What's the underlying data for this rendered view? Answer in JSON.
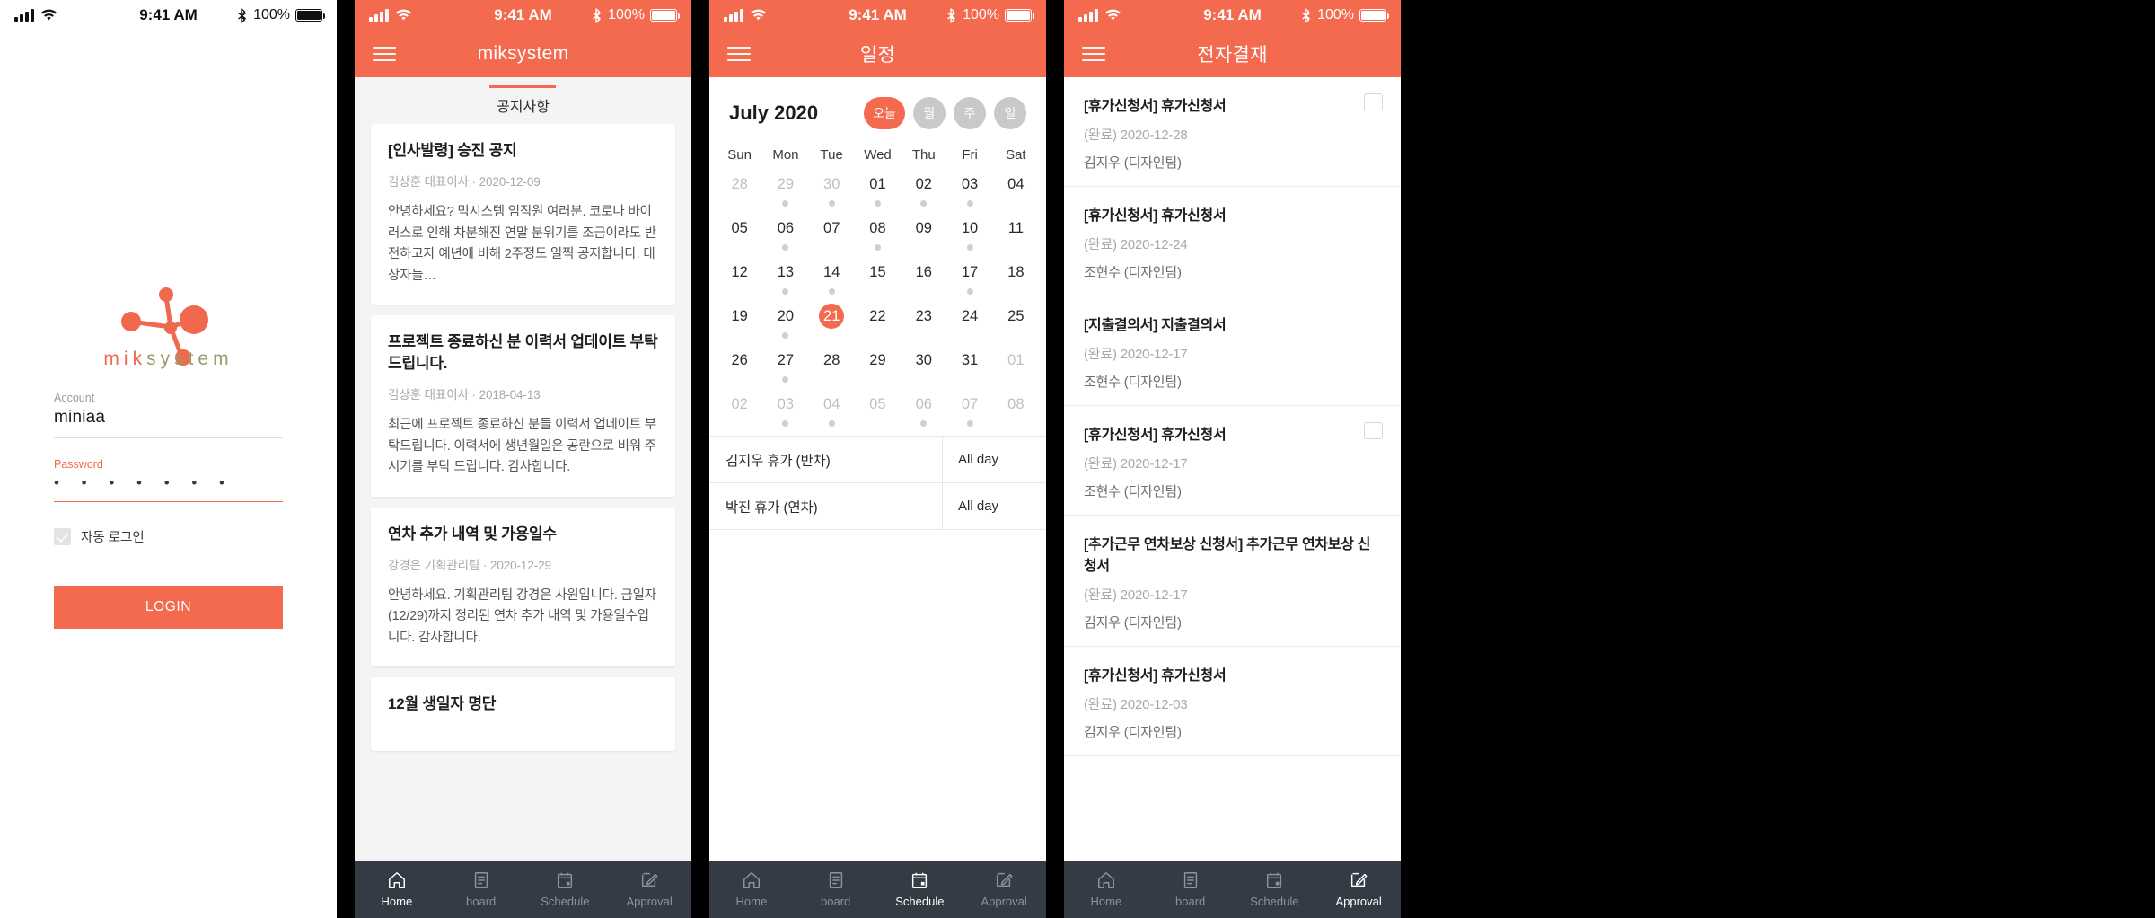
{
  "theme": {
    "accent": "#f36a4f",
    "nav_bg": "#343b45",
    "page_bg": "#f4f4f4"
  },
  "status_bar": {
    "time": "9:41 AM",
    "battery": "100%",
    "signal_icon": "cellular-signal-icon",
    "wifi_icon": "wifi-icon",
    "bluetooth_icon": "bluetooth-icon",
    "battery_icon": "battery-icon"
  },
  "bottom_nav": {
    "items": [
      {
        "label": "Home",
        "icon": "home-icon"
      },
      {
        "label": "board",
        "icon": "document-icon"
      },
      {
        "label": "Schedule",
        "icon": "calendar-icon"
      },
      {
        "label": "Approval",
        "icon": "edit-pencil-icon"
      }
    ]
  },
  "screen_login": {
    "logo": {
      "brand_part_1": "mik",
      "brand_part_2": "system",
      "mark_icon": "miksystem-molecule-logo"
    },
    "account": {
      "label": "Account",
      "value": "miniaa"
    },
    "password": {
      "label": "Password",
      "value": "•  •  •  •  •  •  •"
    },
    "remember": {
      "label": "자동 로그인",
      "checked": true
    },
    "login_button": "LOGIN"
  },
  "screen_board": {
    "app_title": "miksystem",
    "tab": "공지사항",
    "cards": [
      {
        "title": "[인사발령] 승진 공지",
        "meta": "김상훈 대표이사 · 2020-12-09",
        "body": "안녕하세요? 믹시스템 임직원 여러분. 코로나 바이러스로 인해 차분해진 연말 분위기를 조금이라도 반전하고자 예년에 비해 2주정도 일찍 공지합니다. 대상자들…"
      },
      {
        "title": "프로젝트 종료하신 분 이력서 업데이트 부탁드립니다.",
        "meta": "김상훈 대표이사 · 2018-04-13",
        "body": "최근에 프로젝트 종료하신 분들 이력서 업데이트 부탁드립니다. 이력서에 생년월일은 공란으로 비워 주시기를 부탁 드립니다. 감사합니다."
      },
      {
        "title": "연차 추가 내역 및 가용일수",
        "meta": "강경은 기획관리팀  · 2020-12-29",
        "body": "안녕하세요. 기획관리팀 강경은 사원입니다. 금일자(12/29)까지 정리된 연차 추가 내역 및 가용일수입니다. 감사합니다."
      },
      {
        "title": "12월 생일자 명단",
        "meta": "",
        "body": ""
      }
    ]
  },
  "screen_schedule": {
    "app_title": "일정",
    "month_label": "July 2020",
    "view_pills": [
      {
        "label": "오늘",
        "active": true
      },
      {
        "label": "월",
        "active": false
      },
      {
        "label": "주",
        "active": false
      },
      {
        "label": "일",
        "active": false
      }
    ],
    "day_names": [
      "Sun",
      "Mon",
      "Tue",
      "Wed",
      "Thu",
      "Fri",
      "Sat"
    ],
    "weeks": [
      [
        {
          "num": "28",
          "muted": true,
          "dot": false,
          "selected": false
        },
        {
          "num": "29",
          "muted": true,
          "dot": true,
          "selected": false
        },
        {
          "num": "30",
          "muted": true,
          "dot": true,
          "selected": false
        },
        {
          "num": "01",
          "muted": false,
          "dot": true,
          "selected": false
        },
        {
          "num": "02",
          "muted": false,
          "dot": true,
          "selected": false
        },
        {
          "num": "03",
          "muted": false,
          "dot": true,
          "selected": false
        },
        {
          "num": "04",
          "muted": false,
          "dot": false,
          "selected": false
        }
      ],
      [
        {
          "num": "05",
          "muted": false,
          "dot": false,
          "selected": false
        },
        {
          "num": "06",
          "muted": false,
          "dot": true,
          "selected": false
        },
        {
          "num": "07",
          "muted": false,
          "dot": false,
          "selected": false
        },
        {
          "num": "08",
          "muted": false,
          "dot": true,
          "selected": false
        },
        {
          "num": "09",
          "muted": false,
          "dot": false,
          "selected": false
        },
        {
          "num": "10",
          "muted": false,
          "dot": true,
          "selected": false
        },
        {
          "num": "11",
          "muted": false,
          "dot": false,
          "selected": false
        }
      ],
      [
        {
          "num": "12",
          "muted": false,
          "dot": false,
          "selected": false
        },
        {
          "num": "13",
          "muted": false,
          "dot": true,
          "selected": false
        },
        {
          "num": "14",
          "muted": false,
          "dot": true,
          "selected": false
        },
        {
          "num": "15",
          "muted": false,
          "dot": false,
          "selected": false
        },
        {
          "num": "16",
          "muted": false,
          "dot": false,
          "selected": false
        },
        {
          "num": "17",
          "muted": false,
          "dot": true,
          "selected": false
        },
        {
          "num": "18",
          "muted": false,
          "dot": false,
          "selected": false
        }
      ],
      [
        {
          "num": "19",
          "muted": false,
          "dot": false,
          "selected": false
        },
        {
          "num": "20",
          "muted": false,
          "dot": true,
          "selected": false
        },
        {
          "num": "21",
          "muted": false,
          "dot": false,
          "selected": true
        },
        {
          "num": "22",
          "muted": false,
          "dot": false,
          "selected": false
        },
        {
          "num": "23",
          "muted": false,
          "dot": false,
          "selected": false
        },
        {
          "num": "24",
          "muted": false,
          "dot": false,
          "selected": false
        },
        {
          "num": "25",
          "muted": false,
          "dot": false,
          "selected": false
        }
      ],
      [
        {
          "num": "26",
          "muted": false,
          "dot": false,
          "selected": false
        },
        {
          "num": "27",
          "muted": false,
          "dot": true,
          "selected": false
        },
        {
          "num": "28",
          "muted": false,
          "dot": false,
          "selected": false
        },
        {
          "num": "29",
          "muted": false,
          "dot": false,
          "selected": false
        },
        {
          "num": "30",
          "muted": false,
          "dot": false,
          "selected": false
        },
        {
          "num": "31",
          "muted": false,
          "dot": false,
          "selected": false
        },
        {
          "num": "01",
          "muted": true,
          "dot": false,
          "selected": false
        }
      ],
      [
        {
          "num": "02",
          "muted": true,
          "dot": false,
          "selected": false
        },
        {
          "num": "03",
          "muted": true,
          "dot": true,
          "selected": false
        },
        {
          "num": "04",
          "muted": true,
          "dot": true,
          "selected": false
        },
        {
          "num": "05",
          "muted": true,
          "dot": false,
          "selected": false
        },
        {
          "num": "06",
          "muted": true,
          "dot": true,
          "selected": false
        },
        {
          "num": "07",
          "muted": true,
          "dot": true,
          "selected": false
        },
        {
          "num": "08",
          "muted": true,
          "dot": false,
          "selected": false
        }
      ]
    ],
    "events": [
      {
        "name": "김지우 휴가 (반차)",
        "time": "All day"
      },
      {
        "name": "박진 휴가 (연차)",
        "time": "All day"
      }
    ]
  },
  "screen_approval": {
    "app_title": "전자결재",
    "items": [
      {
        "title": "[휴가신청서] 휴가신청서",
        "status": "(완료) 2020-12-28",
        "author": "김지우 (디자인팀)",
        "flag": true
      },
      {
        "title": "[휴가신청서] 휴가신청서",
        "status": "(완료) 2020-12-24",
        "author": "조현수 (디자인팀)",
        "flag": false
      },
      {
        "title": "[지출결의서] 지출결의서",
        "status": "(완료) 2020-12-17",
        "author": "조현수 (디자인팀)",
        "flag": false
      },
      {
        "title": "[휴가신청서] 휴가신청서",
        "status": "(완료) 2020-12-17",
        "author": "조현수 (디자인팀)",
        "flag": true
      },
      {
        "title": "[추가근무 연차보상 신청서] 추가근무 연차보상 신청서",
        "status": "(완료) 2020-12-17",
        "author": "김지우 (디자인팀)",
        "flag": false
      },
      {
        "title": "[휴가신청서] 휴가신청서",
        "status": "(완료) 2020-12-03",
        "author": "김지우 (디자인팀)",
        "flag": false
      }
    ]
  }
}
